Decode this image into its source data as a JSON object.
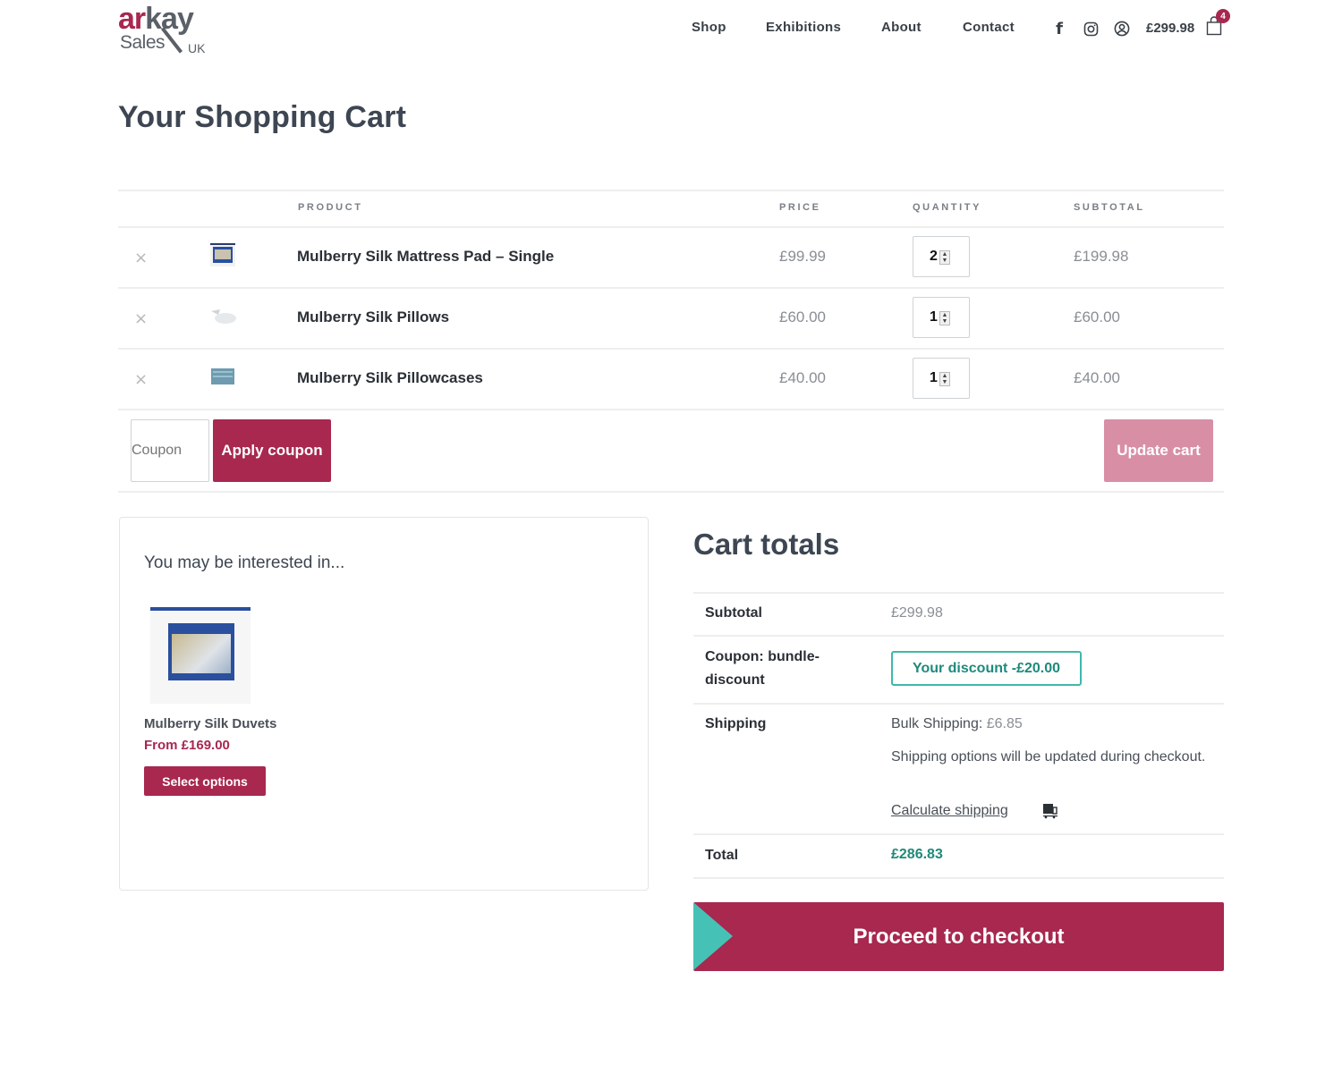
{
  "header": {
    "logo": {
      "line1_a": "ar",
      "line1_b": "kay",
      "line2": "Sales",
      "suffix": "UK"
    },
    "nav": [
      {
        "label": "Shop"
      },
      {
        "label": "Exhibitions"
      },
      {
        "label": "About"
      },
      {
        "label": "Contact"
      }
    ],
    "social_icons": [
      "facebook-icon",
      "instagram-icon",
      "account-icon"
    ],
    "cart_total": "£299.98",
    "cart_count": "4"
  },
  "page": {
    "title": "Your Shopping Cart"
  },
  "cart_table": {
    "headers": {
      "product": "PRODUCT",
      "price": "PRICE",
      "quantity": "QUANTITY",
      "subtotal": "SUBTOTAL"
    },
    "items": [
      {
        "name": "Mulberry Silk Mattress Pad – Single",
        "price": "£99.99",
        "quantity": "2",
        "subtotal": "£199.98",
        "remove": "×"
      },
      {
        "name": "Mulberry Silk Pillows",
        "price": "£60.00",
        "quantity": "1",
        "subtotal": "£60.00",
        "remove": "×"
      },
      {
        "name": "Mulberry Silk Pillowcases",
        "price": "£40.00",
        "quantity": "1",
        "subtotal": "£40.00",
        "remove": "×"
      }
    ],
    "coupon_placeholder": "Coupon",
    "apply_coupon_label": "Apply coupon",
    "update_cart_label": "Update cart"
  },
  "cross_sells": {
    "title": "You may be interested in...",
    "product": {
      "name": "Mulberry Silk Duvets",
      "price": "From £169.00",
      "button": "Select options"
    }
  },
  "cart_totals": {
    "title": "Cart totals",
    "subtotal_label": "Subtotal",
    "subtotal_value": "£299.98",
    "coupon_label": "Coupon: bundle-discount",
    "coupon_value": "Your discount -£20.00",
    "shipping_label": "Shipping",
    "shipping_method": "Bulk Shipping:",
    "shipping_amount": "£6.85",
    "shipping_note": "Shipping options will be updated during checkout.",
    "calculate_shipping": "Calculate shipping",
    "total_label": "Total",
    "total_value": "£286.83",
    "checkout_label": "Proceed to checkout"
  },
  "colors": {
    "brand": "#a8284f",
    "brand_light": "#d88fa6",
    "accent_teal": "#45c2b5",
    "discount_text": "#1e8a7b"
  }
}
